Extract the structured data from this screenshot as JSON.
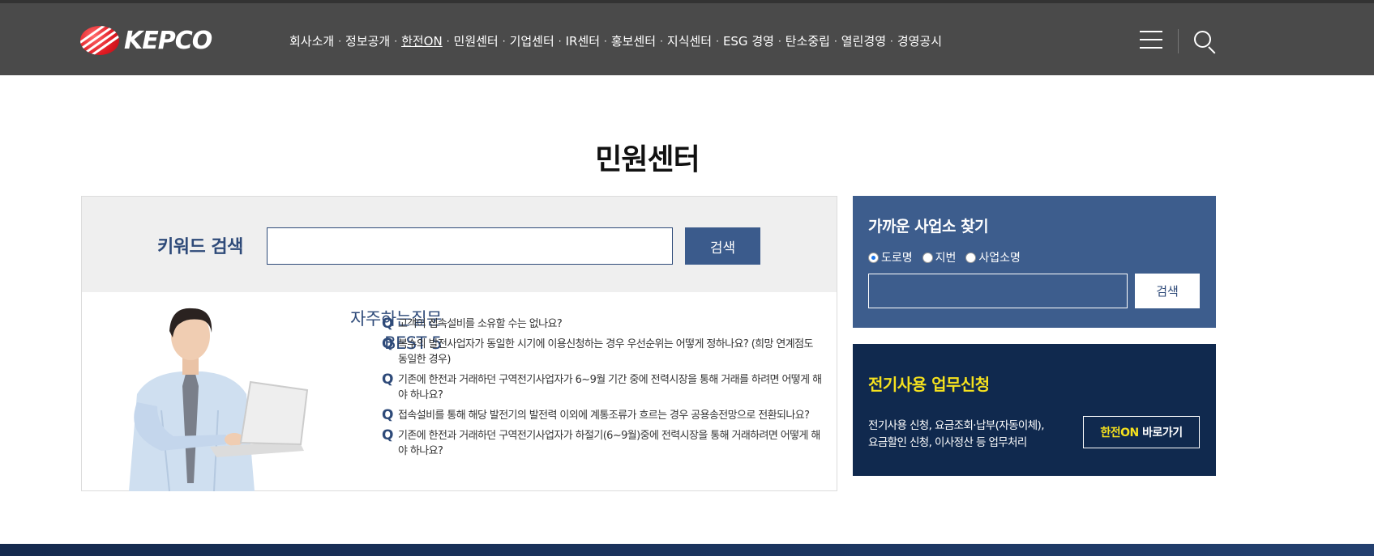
{
  "header": {
    "logo_text": "KEPCO",
    "nav": [
      {
        "label": "회사소개",
        "active": false
      },
      {
        "label": "정보공개",
        "active": false
      },
      {
        "label": "한전ON",
        "active": true
      },
      {
        "label": "민원센터",
        "active": false
      },
      {
        "label": "기업센터",
        "active": false
      },
      {
        "label": "IR센터",
        "active": false
      },
      {
        "label": "홍보센터",
        "active": false
      },
      {
        "label": "지식센터",
        "active": false
      },
      {
        "label": "ESG 경영",
        "active": false
      },
      {
        "label": "탄소중립",
        "active": false
      },
      {
        "label": "열린경영",
        "active": false
      },
      {
        "label": "경영공시",
        "active": false
      }
    ],
    "separator": "·",
    "icons": {
      "menu": "hamburger-menu-icon",
      "search": "search-icon"
    }
  },
  "page_title": "민원센터",
  "keyword_search": {
    "label": "키워드 검색",
    "value": "",
    "button": "검색"
  },
  "faq": {
    "title_line1": "자주하는질문",
    "title_line2": "BEST 5",
    "q_mark": "Q",
    "items": [
      "고객이 접속설비를 소유할 수는 없나요?",
      "복수의 발전사업자가 동일한 시기에 이용신청하는 경우 우선순위는 어떻게 정하나요? (희망 연계점도 동일한 경우)",
      "기존에 한전과 거래하던 구역전기사업자가 6~9월 기간 중에 전력시장을 통해 거래를 하려면 어떻게 해야 하나요?",
      "접속설비를 통해 해당 발전기의 발전력 이외에 계통조류가 흐르는 경우 공용송전망으로 전환되나요?",
      "기존에 한전과 거래하던 구역전기사업자가 하절기(6~9월)중에 전력시장을 통해 거래하려면 어떻게 해야 하나요?"
    ]
  },
  "near_office": {
    "title": "가까운 사업소 찾기",
    "radios": [
      {
        "label": "도로명",
        "checked": true
      },
      {
        "label": "지번",
        "checked": false
      },
      {
        "label": "사업소명",
        "checked": false
      }
    ],
    "value": "",
    "button": "검색"
  },
  "apply": {
    "title": "전기사용 업무신청",
    "desc_line1": "전기사용 신청, 요금조회·납부(자동이체),",
    "desc_line2": "요금할인 신청, 이사정산 등 업무처리",
    "button_highlight": "한전ON",
    "button_rest": " 바로가기"
  },
  "colors": {
    "header_bg": "#4a4a4a",
    "brand_blue": "#3d5d8d",
    "navy": "#10294e",
    "accent_yellow": "#f5e11e"
  }
}
